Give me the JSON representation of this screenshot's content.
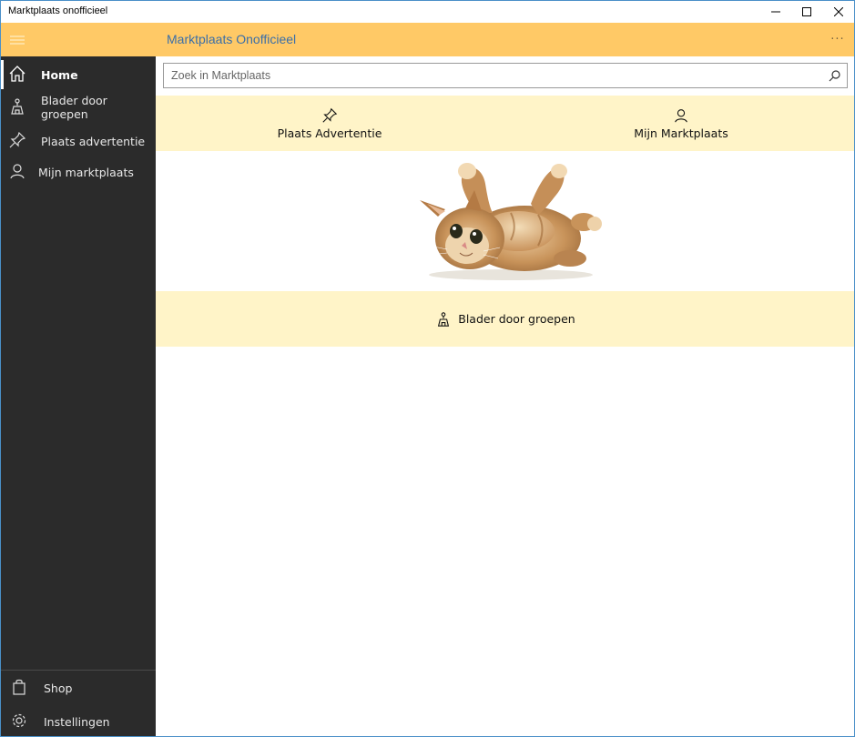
{
  "window": {
    "title": "Marktplaats onofficieel"
  },
  "appbar": {
    "title": "Marktplaats Onofficieel",
    "more_label": "···"
  },
  "sidebar": {
    "items": [
      {
        "label": "Home",
        "icon": "home-icon",
        "active": true
      },
      {
        "label": "Blader door groepen",
        "icon": "groups-icon",
        "active": false
      },
      {
        "label": "Plaats advertentie",
        "icon": "pin-icon",
        "active": false
      },
      {
        "label": "Mijn marktplaats",
        "icon": "person-icon",
        "active": false
      }
    ],
    "footer": [
      {
        "label": "Shop",
        "icon": "shopping-bag-icon"
      },
      {
        "label": "Instellingen",
        "icon": "gear-icon"
      }
    ]
  },
  "search": {
    "placeholder": "Zoek in Marktplaats",
    "value": ""
  },
  "actions": {
    "place_ad": "Plaats Advertentie",
    "my_marktplaats": "Mijn Marktplaats"
  },
  "browse": {
    "label": "Blader door groepen"
  },
  "colors": {
    "accent": "#ffc966",
    "panel": "#fff4c8",
    "sidebar": "#2b2b2b",
    "title_text": "#3b6fa8"
  }
}
